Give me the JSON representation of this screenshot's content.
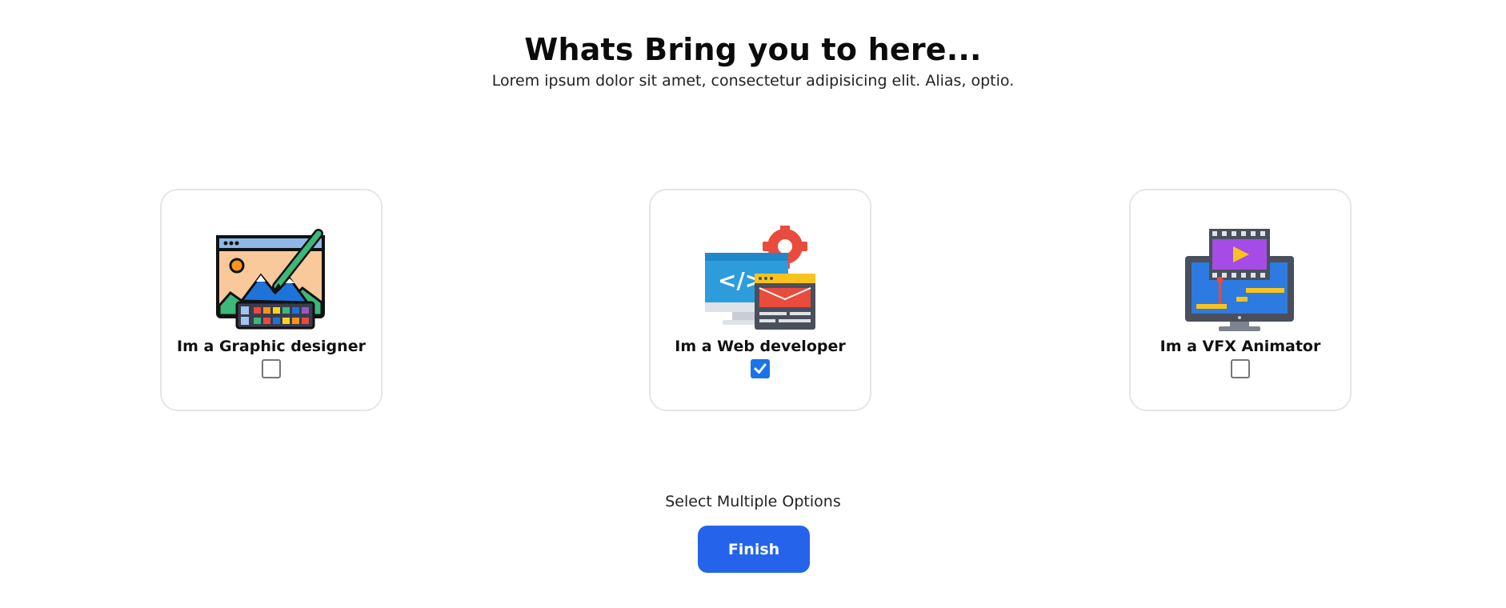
{
  "header": {
    "title": "Whats Bring you to here...",
    "subtitle": "Lorem ipsum dolor sit amet, consectetur adipisicing elit. Alias, optio."
  },
  "options": [
    {
      "label": "Im a Graphic designer",
      "icon": "graphic-design-icon",
      "checked": false
    },
    {
      "label": "Im a Web developer",
      "icon": "web-development-icon",
      "checked": true
    },
    {
      "label": "Im a VFX Animator",
      "icon": "vfx-animation-icon",
      "checked": false
    }
  ],
  "footer": {
    "hint": "Select Multiple Options",
    "finish_label": "Finish"
  },
  "colors": {
    "accent": "#2563eb",
    "checkbox_checked": "#1a73e8",
    "card_border": "#e6e6e6"
  }
}
